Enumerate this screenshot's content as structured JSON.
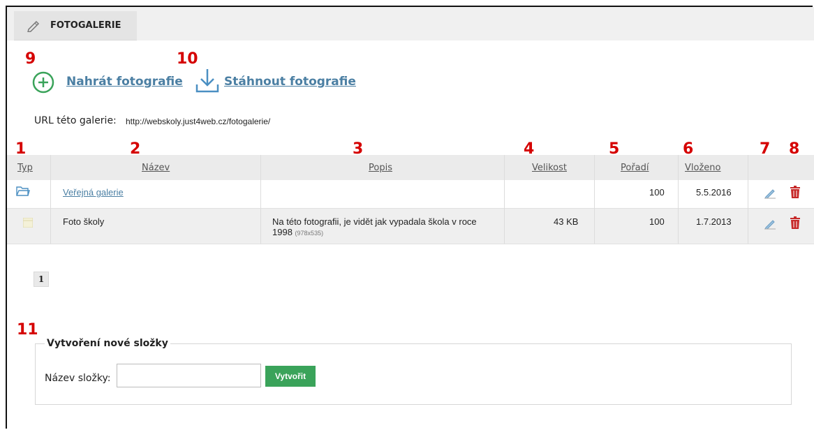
{
  "tab": {
    "label": "FOTOGALERIE",
    "icon": "pencil-icon"
  },
  "annotations": [
    "1",
    "2",
    "3",
    "4",
    "5",
    "6",
    "7",
    "8",
    "9",
    "10",
    "11"
  ],
  "actions": {
    "upload_label": "Nahrát fotografie",
    "download_label": "Stáhnout fotografie",
    "upload_icon": "plus-circle-icon",
    "download_icon": "download-icon"
  },
  "gallery_url": {
    "label": "URL této galerie:",
    "value": "http://webskoly.just4web.cz/fotogalerie/"
  },
  "table": {
    "columns": [
      "Typ",
      "Název",
      "Popis",
      "Velikost",
      "Pořadí",
      "Vloženo"
    ],
    "rows": [
      {
        "type_icon": "folder-icon",
        "name": "Veřejná galerie",
        "description": "",
        "dimensions": "",
        "size": "",
        "order": "100",
        "inserted": "5.5.2016"
      },
      {
        "type_icon": "image-thumbnail-icon",
        "name": "Foto školy",
        "description": "Na této fotografii, je vidět jak vypadala škola v roce 1998",
        "dimensions": "(978x535)",
        "size": "43 KB",
        "order": "100",
        "inserted": "1.7.2013"
      }
    ],
    "row_actions": {
      "edit_icon": "edit-pencil-icon",
      "delete_icon": "trash-icon"
    }
  },
  "pagination": {
    "current_page": "1"
  },
  "new_folder": {
    "legend": "Vytvoření nové složky",
    "field_label": "Název složky:",
    "field_value": "",
    "button_label": "Vytvořit"
  },
  "colors": {
    "link": "#4b7fa3",
    "annotation": "#d50000",
    "create_button": "#3aa35a",
    "upload_icon": "#3aa35a",
    "delete_icon": "#c62828"
  }
}
